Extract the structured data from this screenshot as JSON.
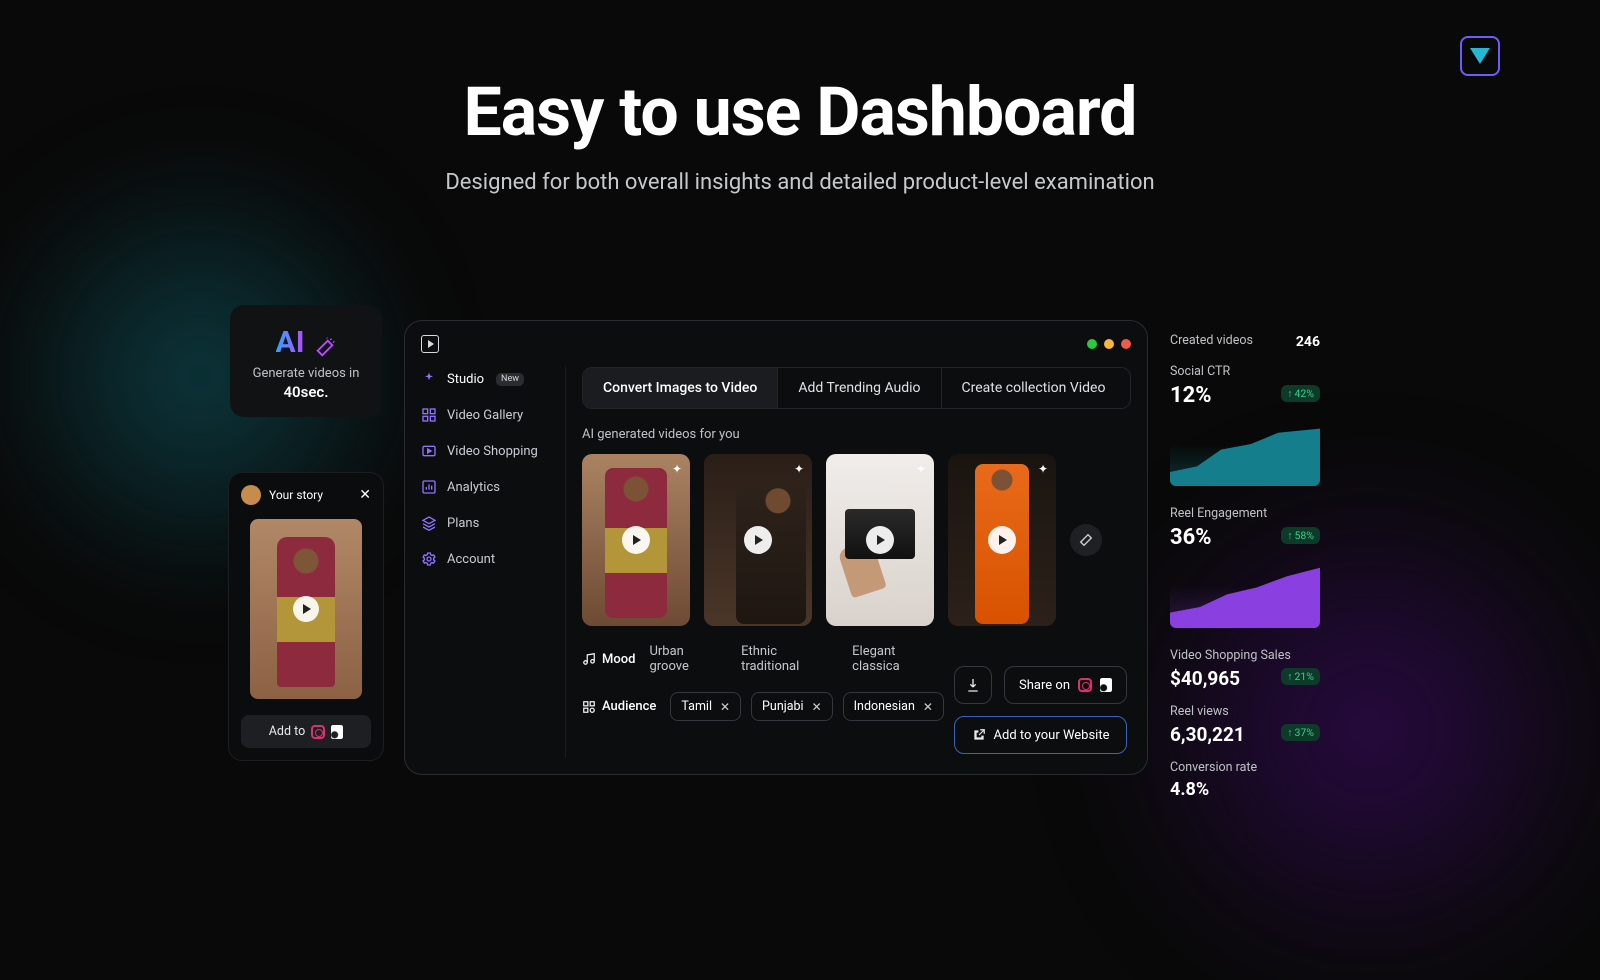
{
  "hero": {
    "title": "Easy to use Dashboard",
    "subtitle": "Designed for both overall insights and detailed product-level examination"
  },
  "ai_card": {
    "badge": "AI",
    "line1": "Generate videos in",
    "line2": "40sec."
  },
  "story": {
    "title": "Your story",
    "add_to": "Add to"
  },
  "sidebar": {
    "items": [
      {
        "label": "Studio",
        "badge": "New"
      },
      {
        "label": "Video Gallery"
      },
      {
        "label": "Video Shopping"
      },
      {
        "label": "Analytics"
      },
      {
        "label": "Plans"
      },
      {
        "label": "Account"
      }
    ]
  },
  "tabs": [
    {
      "label": "Convert Images to Video"
    },
    {
      "label": "Add Trending Audio"
    },
    {
      "label": "Create collection Video"
    }
  ],
  "section_title": "AI generated videos for you",
  "mood": {
    "label": "Mood",
    "options": [
      "Urban groove",
      "Ethnic traditional",
      "Elegant classica"
    ]
  },
  "audience": {
    "label": "Audience",
    "chips": [
      "Tamil",
      "Punjabi",
      "Indonesian"
    ]
  },
  "actions": {
    "share": "Share on",
    "add_web": "Add to your Website"
  },
  "stats": {
    "created_label": "Created videos",
    "created_value": "246",
    "ctr_label": "Social CTR",
    "ctr_value": "12%",
    "ctr_delta": "42%",
    "reel_eng_label": "Reel Engagement",
    "reel_eng_value": "36%",
    "reel_eng_delta": "58%",
    "sales_label": "Video Shopping Sales",
    "sales_value": "$40,965",
    "sales_delta": "21%",
    "views_label": "Reel views",
    "views_value": "6,30,221",
    "views_delta": "37%",
    "conv_label": "Conversion rate",
    "conv_value": "4.8%"
  }
}
